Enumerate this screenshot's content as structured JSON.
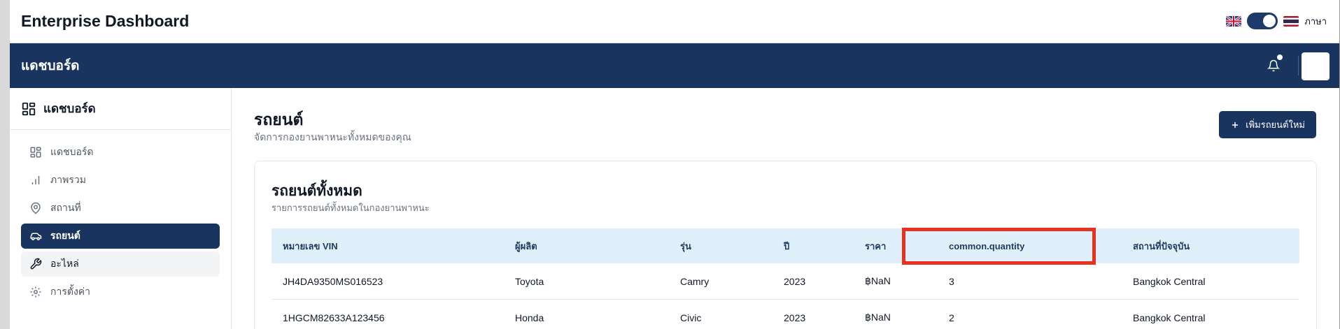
{
  "app": {
    "title": "Enterprise Dashboard"
  },
  "header": {
    "language_label": "ภาษา"
  },
  "navbar": {
    "title": "แดชบอร์ด"
  },
  "sidebar": {
    "heading": "แดชบอร์ด",
    "items": [
      {
        "label": "แดชบอร์ด",
        "icon": "grid-icon"
      },
      {
        "label": "ภาพรวม",
        "icon": "bar-chart-icon"
      },
      {
        "label": "สถานที่",
        "icon": "map-pin-icon"
      },
      {
        "label": "รถยนต์",
        "icon": "car-icon"
      },
      {
        "label": "อะไหล่",
        "icon": "wrench-icon"
      },
      {
        "label": "การตั้งค่า",
        "icon": "gear-icon"
      }
    ]
  },
  "page": {
    "title": "รถยนต์",
    "subtitle": "จัดการกองยานพาหนะทั้งหมดของคุณ",
    "add_button": "เพิ่มรถยนต์ใหม่"
  },
  "card": {
    "title": "รถยนต์ทั้งหมด",
    "subtitle": "รายการรถยนต์ทั้งหมดในกองยานพาหนะ"
  },
  "table": {
    "columns": [
      "หมายเลข VIN",
      "ผู้ผลิต",
      "รุ่น",
      "ปี",
      "ราคา",
      "common.quantity",
      "สถานที่ปัจจุบัน"
    ],
    "rows": [
      [
        "JH4DA9350MS016523",
        "Toyota",
        "Camry",
        "2023",
        "฿NaN",
        "3",
        "Bangkok Central"
      ],
      [
        "1HGCM82633A123456",
        "Honda",
        "Civic",
        "2023",
        "฿NaN",
        "2",
        "Bangkok Central"
      ]
    ]
  },
  "colors": {
    "navy": "#1a3460",
    "table_header_bg": "#e0f0fb",
    "highlight_red": "#e8311f"
  }
}
